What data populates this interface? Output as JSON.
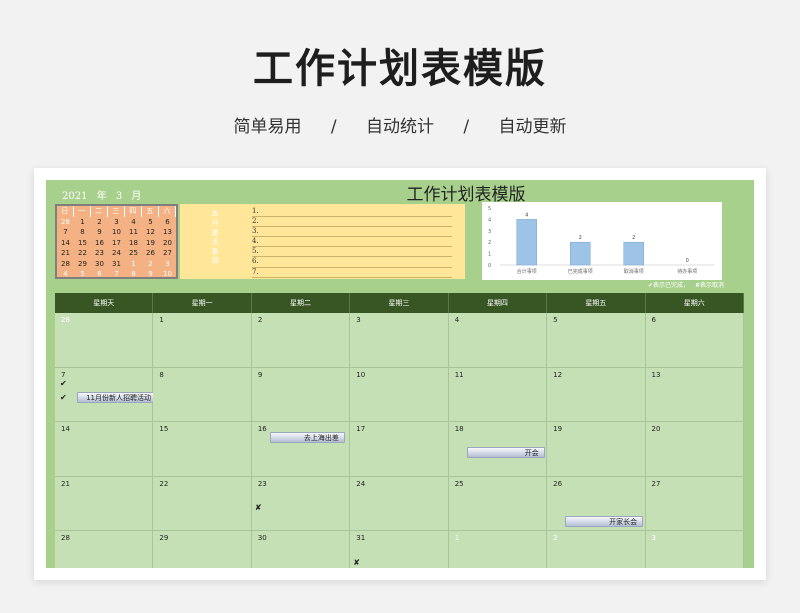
{
  "header": {
    "title": "工作计划表模版",
    "sub1": "简单易用",
    "sub_sep1": "/",
    "sub2": "自动统计",
    "sub_sep2": "/",
    "sub3": "自动更新"
  },
  "sheet": {
    "year": "2021",
    "year_unit": "年",
    "month": "3",
    "month_unit": "月",
    "title": "工作计划表模版"
  },
  "mini_calendar": {
    "headers": [
      "日",
      "一",
      "二",
      "三",
      "四",
      "五",
      "六"
    ],
    "rows": [
      [
        "28",
        "1",
        "2",
        "3",
        "4",
        "5",
        "6"
      ],
      [
        "7",
        "8",
        "9",
        "10",
        "11",
        "12",
        "13"
      ],
      [
        "14",
        "15",
        "16",
        "17",
        "18",
        "19",
        "20"
      ],
      [
        "21",
        "22",
        "23",
        "24",
        "25",
        "26",
        "27"
      ],
      [
        "28",
        "29",
        "30",
        "31",
        "1",
        "2",
        "3"
      ],
      [
        "4",
        "5",
        "6",
        "7",
        "8",
        "9",
        "10"
      ]
    ]
  },
  "todo": {
    "label": "本月重点事项",
    "items": [
      "1.",
      "2.",
      "3.",
      "4.",
      "5.",
      "6.",
      "7."
    ]
  },
  "chart_data": {
    "type": "bar",
    "categories": [
      "合计事项",
      "已完成事项",
      "取消事项",
      "待办事项"
    ],
    "values": [
      4,
      2,
      2,
      0
    ],
    "ylim": [
      0,
      5
    ],
    "yticks": [
      "0",
      "1",
      "2",
      "3",
      "4",
      "5"
    ],
    "bar_color": "#9dc3e6"
  },
  "legend": {
    "done": "✔表示已完成，",
    "cancel": "✘表示取消"
  },
  "calendar": {
    "weekdays": [
      "星期天",
      "星期一",
      "星期二",
      "星期三",
      "星期四",
      "星期五",
      "星期六"
    ],
    "weeks": [
      [
        {
          "d": "28",
          "o": true
        },
        {
          "d": "1"
        },
        {
          "d": "2"
        },
        {
          "d": "3"
        },
        {
          "d": "4"
        },
        {
          "d": "5"
        },
        {
          "d": "6"
        }
      ],
      [
        {
          "d": "7"
        },
        {
          "d": "8"
        },
        {
          "d": "9"
        },
        {
          "d": "10"
        },
        {
          "d": "11"
        },
        {
          "d": "12"
        },
        {
          "d": "13"
        }
      ],
      [
        {
          "d": "14"
        },
        {
          "d": "15"
        },
        {
          "d": "16"
        },
        {
          "d": "17"
        },
        {
          "d": "18"
        },
        {
          "d": "19"
        },
        {
          "d": "20"
        }
      ],
      [
        {
          "d": "21"
        },
        {
          "d": "22"
        },
        {
          "d": "23"
        },
        {
          "d": "24"
        },
        {
          "d": "25"
        },
        {
          "d": "26"
        },
        {
          "d": "27"
        }
      ],
      [
        {
          "d": "28"
        },
        {
          "d": "29"
        },
        {
          "d": "30"
        },
        {
          "d": "31"
        },
        {
          "d": "1",
          "o": true
        },
        {
          "d": "2",
          "o": true
        },
        {
          "d": "3",
          "o": true
        }
      ]
    ],
    "events": {
      "recruit": "11月份新人招聘活动",
      "trip": "去上海出差",
      "meeting": "开会",
      "parents": "开家长会"
    },
    "marks": {
      "check": "✔",
      "cross": "✘"
    }
  }
}
